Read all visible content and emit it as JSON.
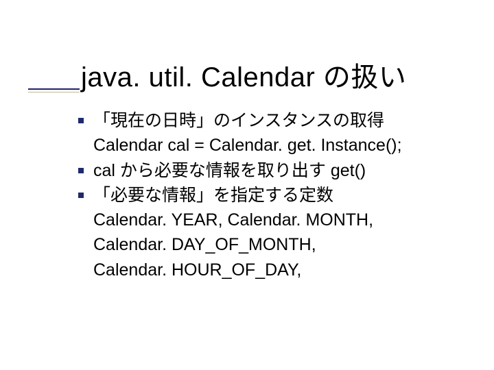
{
  "title": "java. util. Calendar の扱い",
  "bullets": [
    {
      "lines": [
        "「現在の日時」のインスタンスの取得",
        "Calendar cal = Calendar. get. Instance();"
      ]
    },
    {
      "lines": [
        " cal から必要な情報を取り出す get()"
      ]
    },
    {
      "lines": [
        "「必要な情報」を指定する定数",
        "Calendar. YEAR, Calendar. MONTH,",
        "Calendar. DAY_OF_MONTH,",
        "Calendar. HOUR_OF_DAY,"
      ]
    }
  ]
}
